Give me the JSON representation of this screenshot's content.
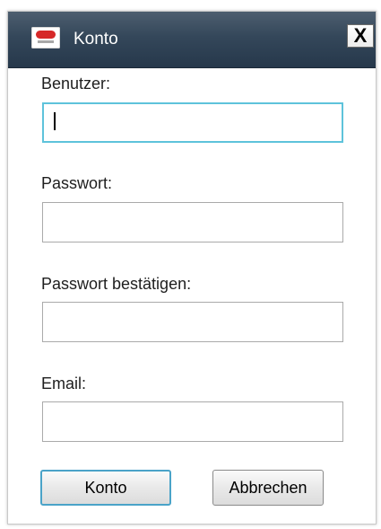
{
  "window": {
    "title": "Konto",
    "close_label": "X"
  },
  "form": {
    "username_label": "Benutzer:",
    "username_value": "",
    "password_label": "Passwort:",
    "password_value": "",
    "confirm_label": "Passwort bestätigen:",
    "confirm_value": "",
    "email_label": "Email:",
    "email_value": ""
  },
  "buttons": {
    "submit_label": "Konto",
    "cancel_label": "Abbrechen"
  },
  "colors": {
    "titlebar": "#34475a",
    "focus_border": "#5ec3db",
    "logo_red": "#d62828"
  },
  "icons": {
    "app": "app-logo-icon",
    "close": "close-icon"
  }
}
